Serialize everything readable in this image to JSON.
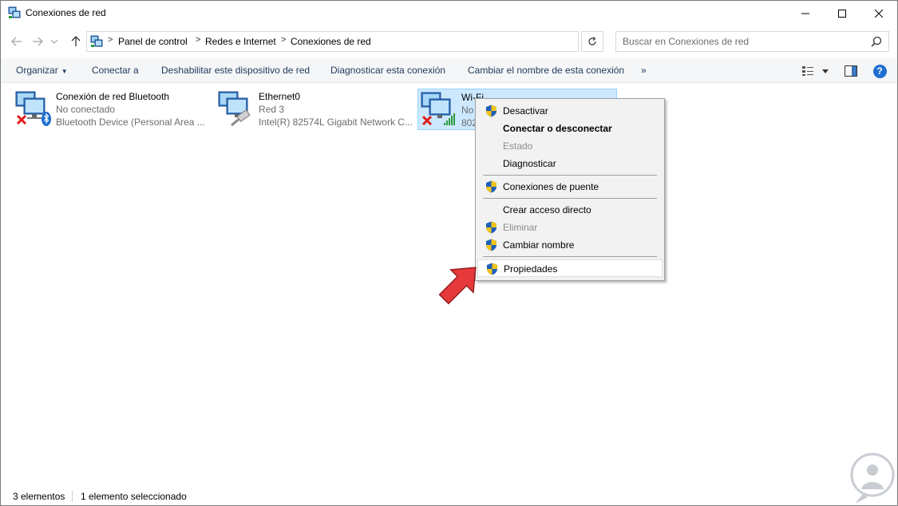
{
  "window": {
    "title": "Conexiones de red",
    "minimize_glyph": "—",
    "maximize_glyph": "☐",
    "close_glyph": "✕"
  },
  "nav": {
    "breadcrumbs": [
      "Panel de control",
      "Redes e Internet",
      "Conexiones de red"
    ],
    "search_placeholder": "Buscar en Conexiones de red"
  },
  "toolbar": {
    "organize": "Organizar",
    "connect": "Conectar a",
    "disable": "Deshabilitar este dispositivo de red",
    "diagnose": "Diagnosticar esta conexión",
    "rename": "Cambiar el nombre de esta conexión",
    "more": "»",
    "help": "?"
  },
  "items": [
    {
      "name": "Conexión de red Bluetooth",
      "status": "No conectado",
      "device": "Bluetooth Device (Personal Area ..."
    },
    {
      "name": "Ethernet0",
      "status": "Red 3",
      "device": "Intel(R) 82574L Gigabit Network C..."
    },
    {
      "name": "Wi-Fi",
      "status": "No",
      "device": "802"
    }
  ],
  "context_menu": {
    "deactivate": "Desactivar",
    "connect_disconnect": "Conectar o desconectar",
    "status": "Estado",
    "diagnose": "Diagnosticar",
    "bridge": "Conexiones de puente",
    "shortcut": "Crear acceso directo",
    "delete": "Eliminar",
    "rename": "Cambiar nombre",
    "properties": "Propiedades"
  },
  "statusbar": {
    "count": "3 elementos",
    "selected": "1 elemento seleccionado"
  },
  "colors": {
    "accent": "#1f6fd0",
    "selection": "#cce8ff",
    "arrow": "#e5393b"
  }
}
